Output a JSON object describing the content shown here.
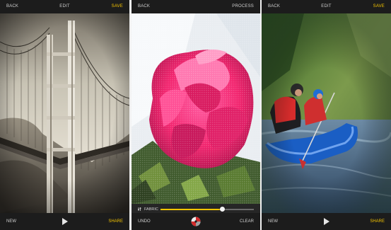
{
  "screens": [
    {
      "top": {
        "left": "BACK",
        "center": "EDIT",
        "right": "SAVE"
      },
      "bottom": {
        "left": "NEW",
        "right": "SHARE"
      },
      "photo": "golden-gate-bridge-sepia",
      "accent": "#f5c400"
    },
    {
      "top": {
        "left": "BACK",
        "right": "PROCESS"
      },
      "slider": {
        "label": "FABRIC",
        "value": 0.66
      },
      "bottom": {
        "left": "UNDO",
        "right": "CLEAR"
      },
      "photo": "pink-rose-fabric-texture"
    },
    {
      "top": {
        "left": "BACK",
        "center": "EDIT",
        "right": "SAVE"
      },
      "bottom": {
        "left": "NEW",
        "right": "SHARE"
      },
      "photo": "kayakers-motion-blur"
    }
  ]
}
